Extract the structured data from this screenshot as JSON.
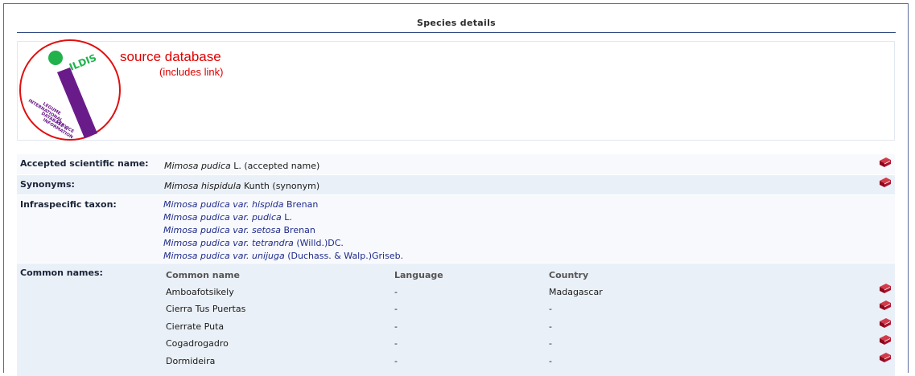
{
  "section": {
    "title": "Species details"
  },
  "source": {
    "logo_text": "ILDIS",
    "logo_lines": [
      "INTERNATIONAL",
      "LEGUME",
      "DATABASE &",
      "INFORMATION",
      "SERVICE"
    ],
    "label": "source database",
    "link_note": "(includes link)",
    "colors": {
      "red": "#e00000",
      "green": "#22b24c",
      "purple": "#6a1b8a"
    }
  },
  "accepted": {
    "label": "Accepted scientific name:",
    "genus_species": "Mimosa pudica",
    "rest": " L. (accepted name)"
  },
  "synonyms": {
    "label": "Synonyms:",
    "genus_species": "Mimosa hispidula",
    "rest": " Kunth (synonym)"
  },
  "infraspecific": {
    "label": "Infraspecific taxon:",
    "items": [
      {
        "name": "Mimosa pudica var. hispida",
        "author": " Brenan"
      },
      {
        "name": "Mimosa pudica var. pudica",
        "author": " L."
      },
      {
        "name": "Mimosa pudica var. setosa",
        "author": " Brenan"
      },
      {
        "name": "Mimosa pudica var. tetrandra",
        "author": " (Willd.)DC."
      },
      {
        "name": "Mimosa pudica var. unijuga",
        "author": " (Duchass. & Walp.)Griseb."
      }
    ]
  },
  "common_names": {
    "label": "Common names:",
    "headers": [
      "Common name",
      "Language",
      "Country"
    ],
    "rows": [
      [
        "Amboafotsikely",
        "-",
        "Madagascar"
      ],
      [
        "Cierra Tus Puertas",
        "-",
        "-"
      ],
      [
        "Cierrate Puta",
        "-",
        "-"
      ],
      [
        "Cogadrogadro",
        "-",
        "-"
      ],
      [
        "Dormideira",
        "-",
        "-"
      ]
    ]
  },
  "icons": {
    "reference": "book-icon",
    "book_color": "#b0102a"
  }
}
